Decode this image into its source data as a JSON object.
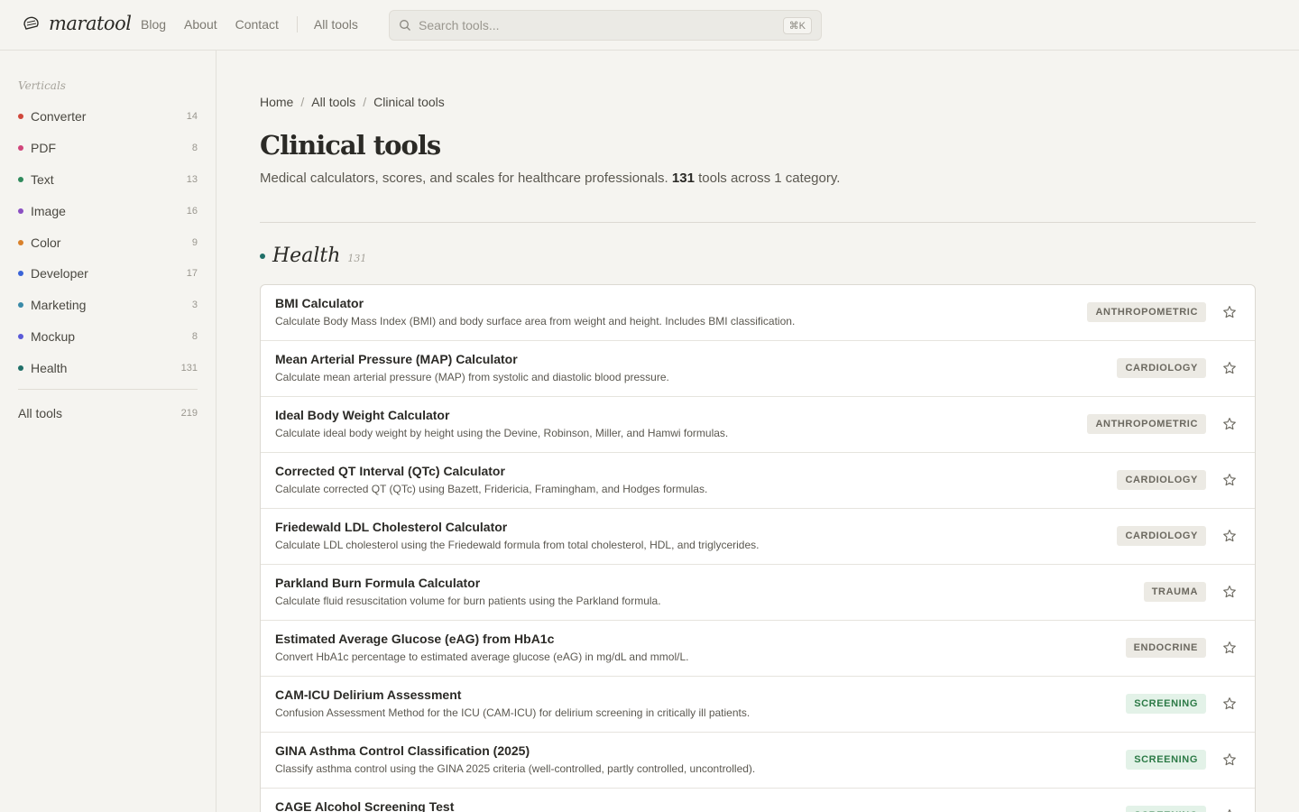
{
  "brand": {
    "name": "maratool"
  },
  "nav": {
    "blog": "Blog",
    "about": "About",
    "contact": "Contact",
    "all_tools": "All tools"
  },
  "search": {
    "placeholder": "Search tools...",
    "shortcut": "⌘K"
  },
  "sidebar": {
    "heading": "Verticals",
    "items": [
      {
        "label": "Converter",
        "count": "14",
        "color": "#d0473b"
      },
      {
        "label": "PDF",
        "count": "8",
        "color": "#d0447a"
      },
      {
        "label": "Text",
        "count": "13",
        "color": "#2f8a5c"
      },
      {
        "label": "Image",
        "count": "16",
        "color": "#8a4fc2"
      },
      {
        "label": "Color",
        "count": "9",
        "color": "#d9812b"
      },
      {
        "label": "Developer",
        "count": "17",
        "color": "#3a64d8"
      },
      {
        "label": "Marketing",
        "count": "3",
        "color": "#3a8aa8"
      },
      {
        "label": "Mockup",
        "count": "8",
        "color": "#5a5ad8"
      },
      {
        "label": "Health",
        "count": "131",
        "color": "#1f6f68"
      }
    ],
    "all": {
      "label": "All tools",
      "count": "219"
    }
  },
  "breadcrumb": {
    "home": "Home",
    "all": "All tools",
    "current": "Clinical tools"
  },
  "page": {
    "title": "Clinical tools",
    "subtitle_pre": "Medical calculators, scores, and scales for healthcare professionals.",
    "tool_count": "131",
    "subtitle_post": "tools across 1 category."
  },
  "section": {
    "name": "Health",
    "count": "131"
  },
  "tools": [
    {
      "title": "BMI Calculator",
      "desc": "Calculate Body Mass Index (BMI) and body surface area from weight and height. Includes BMI classification.",
      "tag": "ANTHROPOMETRIC",
      "tag_style": "gray"
    },
    {
      "title": "Mean Arterial Pressure (MAP) Calculator",
      "desc": "Calculate mean arterial pressure (MAP) from systolic and diastolic blood pressure.",
      "tag": "CARDIOLOGY",
      "tag_style": "gray"
    },
    {
      "title": "Ideal Body Weight Calculator",
      "desc": "Calculate ideal body weight by height using the Devine, Robinson, Miller, and Hamwi formulas.",
      "tag": "ANTHROPOMETRIC",
      "tag_style": "gray"
    },
    {
      "title": "Corrected QT Interval (QTc) Calculator",
      "desc": "Calculate corrected QT (QTc) using Bazett, Fridericia, Framingham, and Hodges formulas.",
      "tag": "CARDIOLOGY",
      "tag_style": "gray"
    },
    {
      "title": "Friedewald LDL Cholesterol Calculator",
      "desc": "Calculate LDL cholesterol using the Friedewald formula from total cholesterol, HDL, and triglycerides.",
      "tag": "CARDIOLOGY",
      "tag_style": "gray"
    },
    {
      "title": "Parkland Burn Formula Calculator",
      "desc": "Calculate fluid resuscitation volume for burn patients using the Parkland formula.",
      "tag": "TRAUMA",
      "tag_style": "gray"
    },
    {
      "title": "Estimated Average Glucose (eAG) from HbA1c",
      "desc": "Convert HbA1c percentage to estimated average glucose (eAG) in mg/dL and mmol/L.",
      "tag": "ENDOCRINE",
      "tag_style": "gray"
    },
    {
      "title": "CAM-ICU Delirium Assessment",
      "desc": "Confusion Assessment Method for the ICU (CAM-ICU) for delirium screening in critically ill patients.",
      "tag": "SCREENING",
      "tag_style": "green"
    },
    {
      "title": "GINA Asthma Control Classification (2025)",
      "desc": "Classify asthma control using the GINA 2025 criteria (well-controlled, partly controlled, uncontrolled).",
      "tag": "SCREENING",
      "tag_style": "green"
    },
    {
      "title": "CAGE Alcohol Screening Test",
      "desc": "",
      "tag": "SCREENING",
      "tag_style": "green"
    }
  ]
}
